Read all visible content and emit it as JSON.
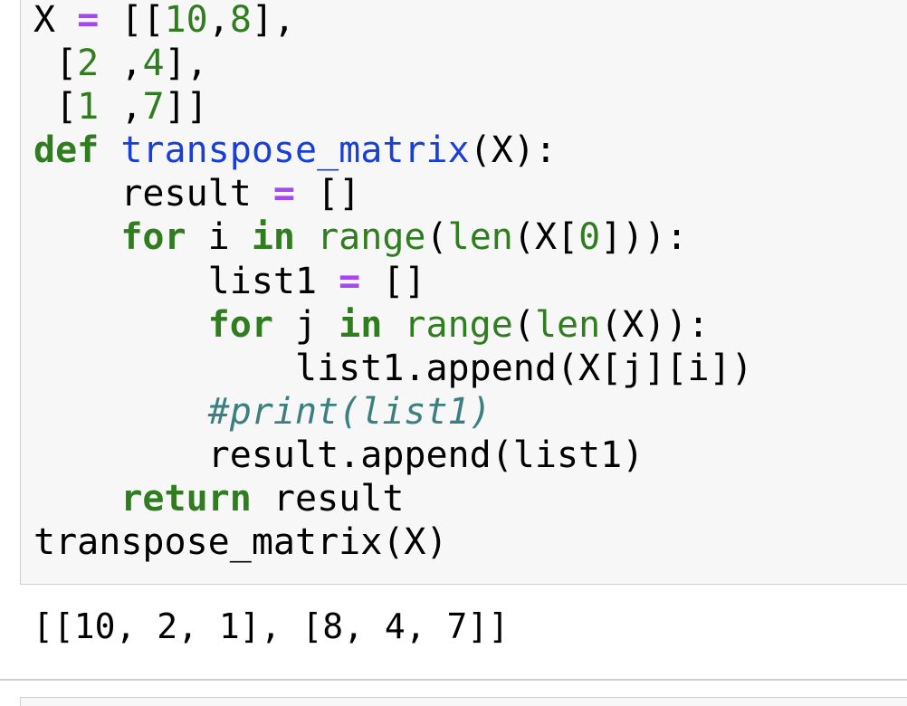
{
  "cell": {
    "code_lines": [
      [
        [
          "X",
          "plain"
        ],
        [
          " ",
          "plain"
        ],
        [
          "=",
          "op"
        ],
        [
          " ",
          "plain"
        ],
        [
          "[[",
          "plain"
        ],
        [
          "10",
          "num"
        ],
        [
          ",",
          "plain"
        ],
        [
          "8",
          "num"
        ],
        [
          "],",
          "plain"
        ]
      ],
      [
        [
          " [",
          "plain"
        ],
        [
          "2",
          "num"
        ],
        [
          " ,",
          "plain"
        ],
        [
          "4",
          "num"
        ],
        [
          "],",
          "plain"
        ]
      ],
      [
        [
          " [",
          "plain"
        ],
        [
          "1",
          "num"
        ],
        [
          " ,",
          "plain"
        ],
        [
          "7",
          "num"
        ],
        [
          "]]",
          "plain"
        ]
      ],
      [
        [
          "def",
          "kw"
        ],
        [
          " ",
          "plain"
        ],
        [
          "transpose_matrix",
          "fn"
        ],
        [
          "(X):",
          "plain"
        ]
      ],
      [
        [
          "    result ",
          "plain"
        ],
        [
          "=",
          "op"
        ],
        [
          " []",
          "plain"
        ]
      ],
      [
        [
          "    ",
          "plain"
        ],
        [
          "for",
          "kw"
        ],
        [
          " i ",
          "plain"
        ],
        [
          "in",
          "kw"
        ],
        [
          " ",
          "plain"
        ],
        [
          "range",
          "bi"
        ],
        [
          "(",
          "plain"
        ],
        [
          "len",
          "bi"
        ],
        [
          "(X[",
          "plain"
        ],
        [
          "0",
          "num"
        ],
        [
          "])):",
          "plain"
        ]
      ],
      [
        [
          "        list1 ",
          "plain"
        ],
        [
          "=",
          "op"
        ],
        [
          " []",
          "plain"
        ]
      ],
      [
        [
          "        ",
          "plain"
        ],
        [
          "for",
          "kw"
        ],
        [
          " j ",
          "plain"
        ],
        [
          "in",
          "kw"
        ],
        [
          " ",
          "plain"
        ],
        [
          "range",
          "bi"
        ],
        [
          "(",
          "plain"
        ],
        [
          "len",
          "bi"
        ],
        [
          "(X)):",
          "plain"
        ]
      ],
      [
        [
          "            list1.append(X[j][i])",
          "plain"
        ]
      ],
      [
        [
          "        ",
          "plain"
        ],
        [
          "#print(list1)",
          "cm"
        ]
      ],
      [
        [
          "        result.append(list1)",
          "plain"
        ]
      ],
      [
        [
          "    ",
          "plain"
        ],
        [
          "return",
          "kw"
        ],
        [
          " result",
          "plain"
        ]
      ],
      [
        [
          "transpose_matrix(X)",
          "plain"
        ]
      ]
    ],
    "output": "[[10, 2, 1], [8, 4, 7]]"
  },
  "colors": {
    "keyword": "#2f7d1e",
    "function_name": "#1a3fd6",
    "operator": "#a548f0",
    "number": "#2f7d1e",
    "comment": "#3d7f80",
    "cell_background": "#f7f7f7",
    "cell_border": "#cfcfcf"
  }
}
